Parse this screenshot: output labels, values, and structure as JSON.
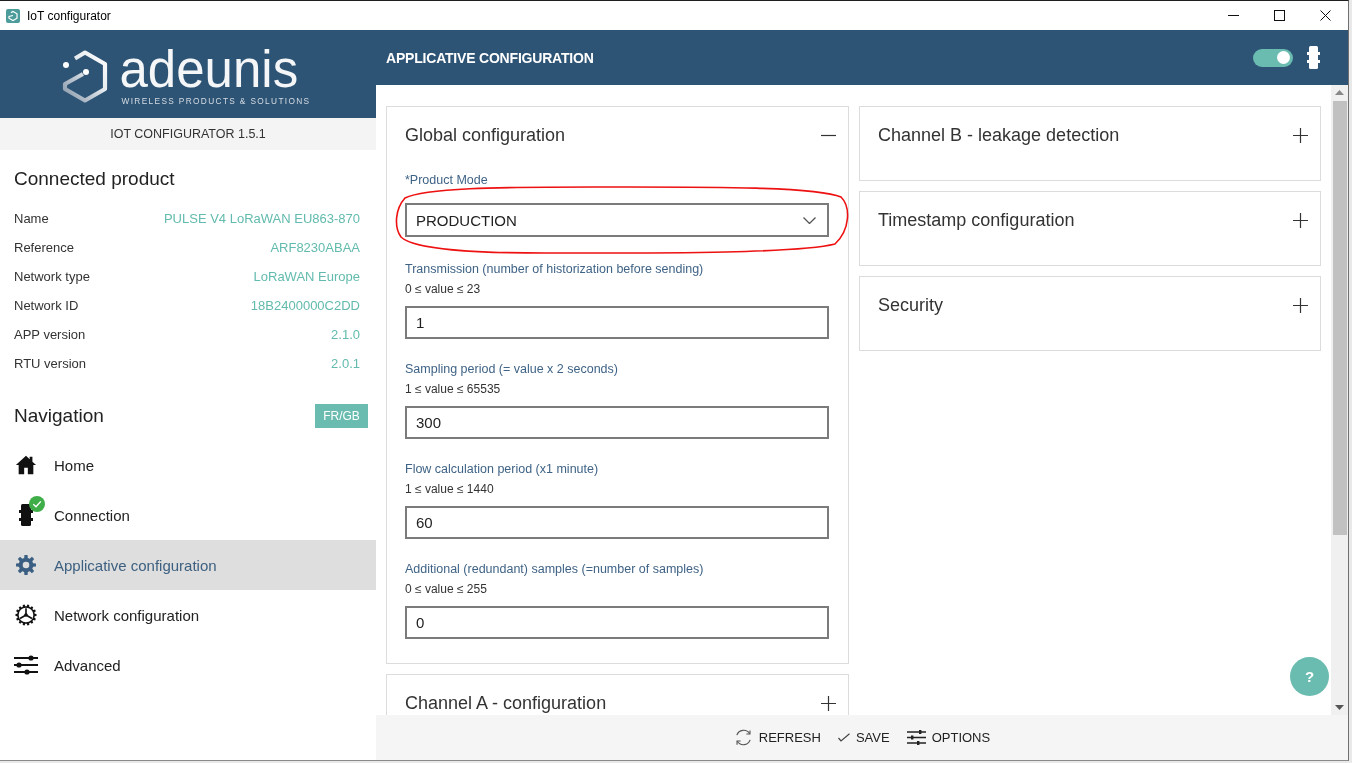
{
  "window": {
    "title": "IoT configurator"
  },
  "brand": {
    "name": "adeunis",
    "tagline": "WIRELESS PRODUCTS & SOLUTIONS",
    "version": "IOT CONFIGURATOR 1.5.1"
  },
  "product": {
    "heading": "Connected product",
    "fields": [
      {
        "label": "Name",
        "value": "PULSE V4 LoRaWAN EU863-870"
      },
      {
        "label": "Reference",
        "value": "ARF8230ABAA"
      },
      {
        "label": "Network type",
        "value": "LoRaWAN Europe"
      },
      {
        "label": "Network ID",
        "value": "18B2400000C2DD"
      },
      {
        "label": "APP version",
        "value": "2.1.0"
      },
      {
        "label": "RTU version",
        "value": "2.0.1"
      }
    ]
  },
  "navigation": {
    "heading": "Navigation",
    "language_button": "FR/GB",
    "items": [
      {
        "kind": "home",
        "label": "Home",
        "selected": false,
        "connected": false
      },
      {
        "kind": "connection",
        "label": "Connection",
        "selected": false,
        "connected": true
      },
      {
        "kind": "applicative",
        "label": "Applicative configuration",
        "selected": true,
        "connected": false
      },
      {
        "kind": "network",
        "label": "Network configuration",
        "selected": false,
        "connected": false
      },
      {
        "kind": "advanced",
        "label": "Advanced",
        "selected": false,
        "connected": false
      }
    ]
  },
  "header": {
    "title": "APPLICATIVE CONFIGURATION",
    "toggle": {
      "on": true
    }
  },
  "columns": [
    {
      "panels": [
        {
          "title": "Global configuration",
          "expanded": true,
          "fields": [
            {
              "kind": "select",
              "label": "*Product Mode",
              "value": "PRODUCTION",
              "highlighted": true
            },
            {
              "kind": "number",
              "label": "Transmission (number of historization before sending)",
              "range": "0 ≤ value ≤ 23",
              "value": "1"
            },
            {
              "kind": "number",
              "label": "Sampling period (= value x 2 seconds)",
              "range": "1 ≤ value ≤ 65535",
              "value": "300"
            },
            {
              "kind": "number",
              "label": "Flow calculation period (x1 minute)",
              "range": "1 ≤ value ≤ 1440",
              "value": "60"
            },
            {
              "kind": "number",
              "label": "Additional (redundant) samples (=number of samples)",
              "range": "0 ≤ value ≤ 255",
              "value": "0"
            }
          ]
        },
        {
          "title": "Channel A - configuration",
          "expanded": false
        }
      ]
    },
    {
      "panels": [
        {
          "title": "Channel B - leakage detection",
          "expanded": false
        },
        {
          "title": "Timestamp configuration",
          "expanded": false
        },
        {
          "title": "Security",
          "expanded": false
        }
      ]
    }
  ],
  "help_button": "?",
  "actions": [
    {
      "kind": "refresh",
      "label": "REFRESH"
    },
    {
      "kind": "save",
      "label": "SAVE"
    },
    {
      "kind": "options",
      "label": "OPTIONS"
    }
  ]
}
